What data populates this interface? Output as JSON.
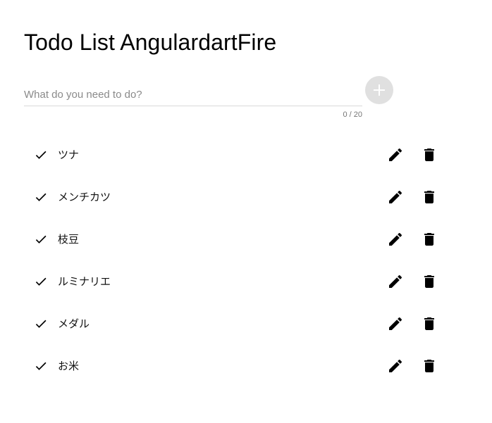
{
  "title": "Todo List AngulardartFire",
  "input": {
    "placeholder": "What do you need to do?",
    "value": "",
    "counter": "0 / 20"
  },
  "add_button": {
    "icon": "plus-icon"
  },
  "todos": [
    {
      "label": "ツナ"
    },
    {
      "label": "メンチカツ"
    },
    {
      "label": "枝豆"
    },
    {
      "label": "ルミナリエ"
    },
    {
      "label": "メダル"
    },
    {
      "label": "お米"
    }
  ],
  "icons": {
    "check": "check-icon",
    "edit": "pencil-icon",
    "delete": "trash-icon"
  },
  "colors": {
    "add_button_bg": "#e0e0e0",
    "add_button_icon": "#ffffff",
    "icon_color": "#000000"
  }
}
